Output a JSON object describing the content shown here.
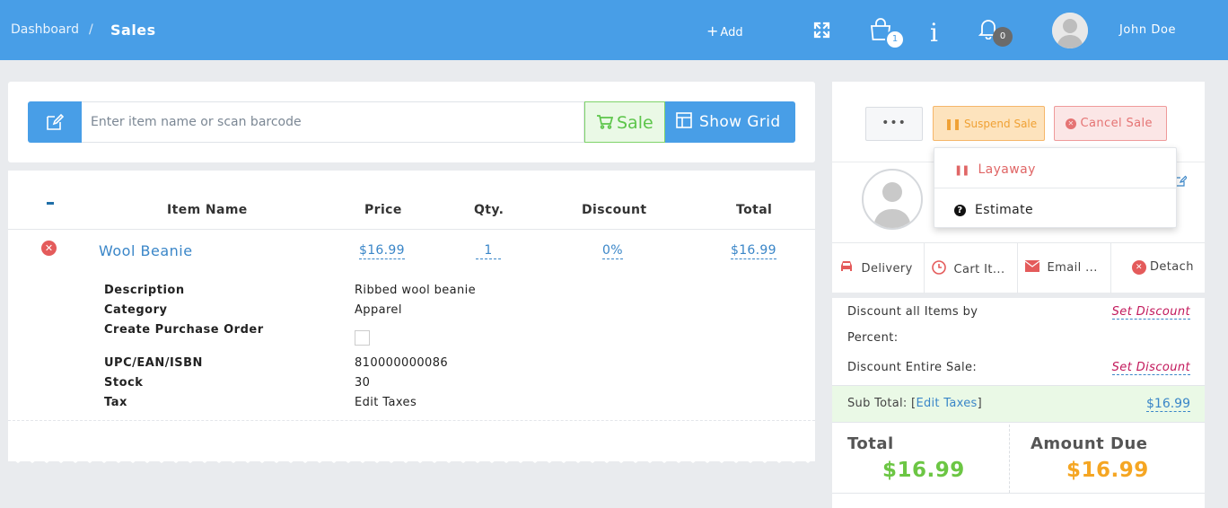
{
  "header": {
    "breadcrumb_root": "Dashboard",
    "breadcrumb_sep": "/",
    "page_title": "Sales",
    "add_label": "Add",
    "cart_count": "1",
    "notification_count": "0",
    "user_name": "John Doe",
    "bar_color": "#489ee7"
  },
  "search": {
    "placeholder": "Enter item name or scan barcode",
    "sale_label": "Sale",
    "show_grid_label": "Show Grid"
  },
  "cart_table": {
    "columns": [
      "Item Name",
      "Price",
      "Qty.",
      "Discount",
      "Total"
    ],
    "item": {
      "name": "Wool Beanie",
      "price": "$16.99",
      "qty": "1",
      "discount": "0%",
      "total": "$16.99",
      "details": [
        {
          "label": "Description",
          "value": "Ribbed wool beanie"
        },
        {
          "label": "Category",
          "value": "Apparel"
        },
        {
          "label": "Create Purchase Order",
          "value": ""
        },
        {
          "label": "UPC/EAN/ISBN",
          "value": "810000000086"
        },
        {
          "label": "Stock",
          "value": "30"
        },
        {
          "label": "Tax",
          "value": "Edit Taxes"
        }
      ]
    }
  },
  "sale_actions": {
    "more_label": "•••",
    "suspend_label": "Suspend Sale",
    "cancel_label": "Cancel Sale"
  },
  "suspend_menu": {
    "items": [
      {
        "label": "Layaway",
        "icon": "pause-icon"
      },
      {
        "label": "Estimate",
        "icon": "question-icon"
      }
    ]
  },
  "customer_actions": [
    {
      "label": "Delivery",
      "icon": "car-icon"
    },
    {
      "label": "Cart It...",
      "icon": "clock-icon"
    },
    {
      "label": "Email ...",
      "icon": "envelope-icon"
    },
    {
      "label": "Detach",
      "icon": "close-circle-icon"
    }
  ],
  "summary": {
    "discount_items_label_1": "Discount all Items by",
    "discount_items_label_2": "Percent:",
    "discount_entire_label": "Discount Entire Sale:",
    "set_discount_label": "Set Discount",
    "subtotal_label": "Sub Total:",
    "edit_taxes_label": "Edit Taxes",
    "subtotal_value": "$16.99",
    "total_label": "Total",
    "total_value": "$16.99",
    "amount_due_label": "Amount Due",
    "amount_due_value": "$16.99",
    "total_color": "#6cc644",
    "amount_due_color": "#f5a623"
  }
}
